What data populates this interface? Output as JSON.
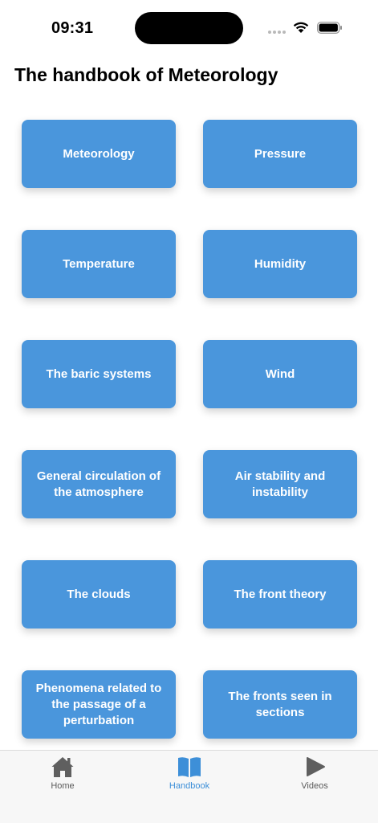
{
  "status_bar": {
    "time": "09:31"
  },
  "title": "The handbook of Meteorology",
  "topics": [
    "Meteorology",
    "Pressure",
    "Temperature",
    "Humidity",
    "The baric systems",
    "Wind",
    "General circulation of the atmosphere",
    "Air stability and instability",
    "The clouds",
    "The front theory",
    "Phenomena related to the passage of a perturbation",
    "The fronts seen in sections"
  ],
  "tab_bar": {
    "items": [
      {
        "label": "Home",
        "icon": "home-icon"
      },
      {
        "label": "Handbook",
        "icon": "book-icon",
        "active": true
      },
      {
        "label": "Videos",
        "icon": "play-icon"
      }
    ]
  },
  "colors": {
    "tile": "#4a96dc",
    "accent": "#3d8fd8"
  }
}
